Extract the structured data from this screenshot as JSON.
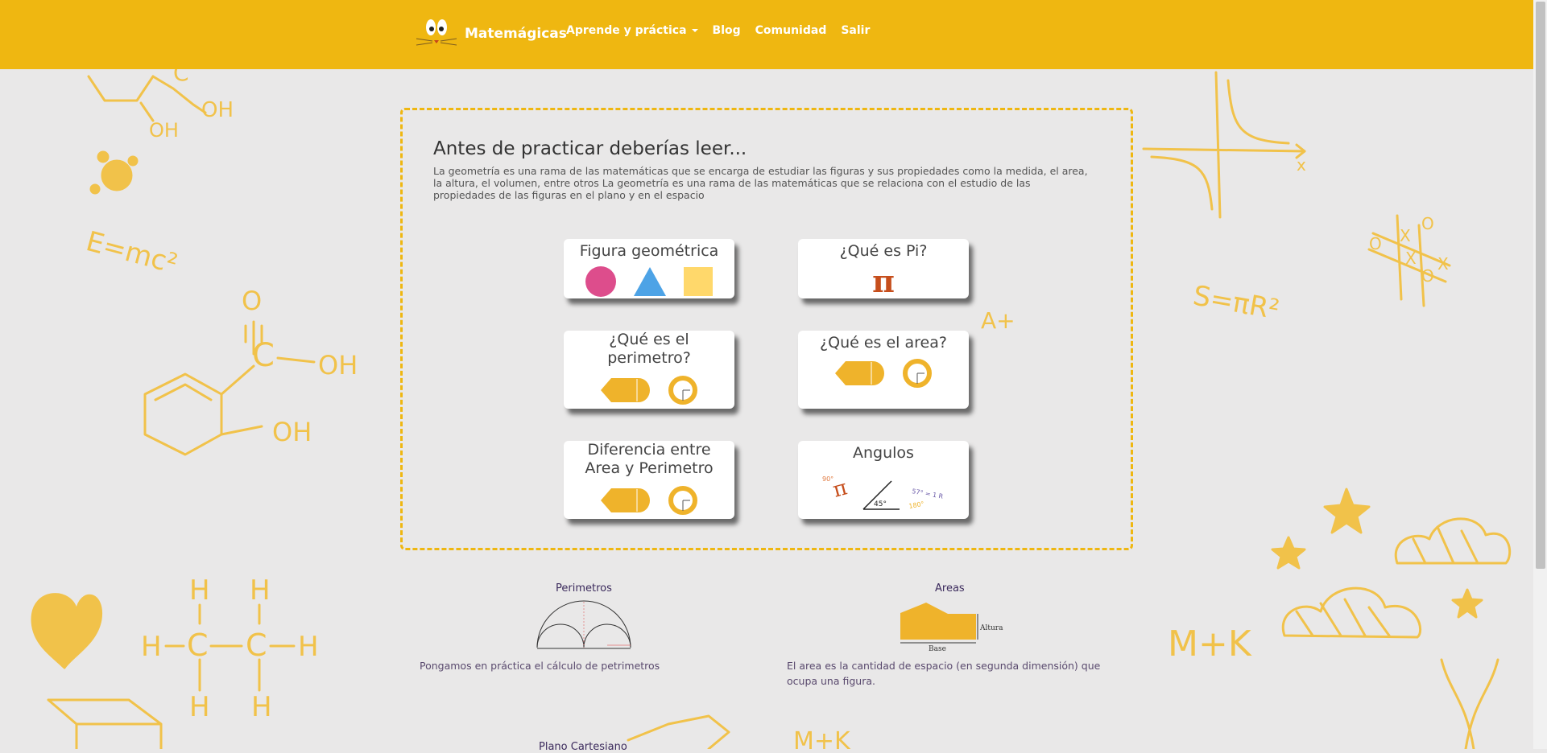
{
  "nav": {
    "brand": "Matemágicas",
    "items": [
      {
        "label": "Aprende y práctica",
        "dropdown": true
      },
      {
        "label": "Blog"
      },
      {
        "label": "Comunidad"
      },
      {
        "label": "Salir"
      }
    ]
  },
  "intro": {
    "title": "Antes de practicar deberías leer...",
    "text": "La geometría es una rama de las matemáticas que se encarga de estudiar las figuras y sus propiedades como la medida, el area, la altura, el volumen, entre otros La geometría es una rama de las matemáticas que se relaciona con el estudio de las propiedades de las figuras en el plano y en el espacio"
  },
  "cards": [
    {
      "title": "Figura geométrica"
    },
    {
      "title": "¿Qué es Pi?"
    },
    {
      "title": "¿Qué es el perimetro?"
    },
    {
      "title": "¿Qué es el area?"
    },
    {
      "title": "Diferencia entre Area y Perimetro"
    },
    {
      "title": "Angulos"
    }
  ],
  "sections": [
    {
      "title": "Perimetros",
      "text": "Pongamos en práctica el cálculo de petrimetros"
    },
    {
      "title": "Areas",
      "text": "El area es la cantidad de espacio (en segunda dimensión) que ocupa una figura.",
      "labels": {
        "height": "Altura",
        "base": "Base"
      }
    },
    {
      "title": "Plano Cartesiano"
    }
  ],
  "icons": {
    "pi_symbol": "π",
    "angle_label": "45°"
  },
  "colors": {
    "accent": "#efb711",
    "circle": "#dd4d8c",
    "triangle": "#4da3e6",
    "square": "#ffd86b",
    "pi": "#c64e1c"
  }
}
